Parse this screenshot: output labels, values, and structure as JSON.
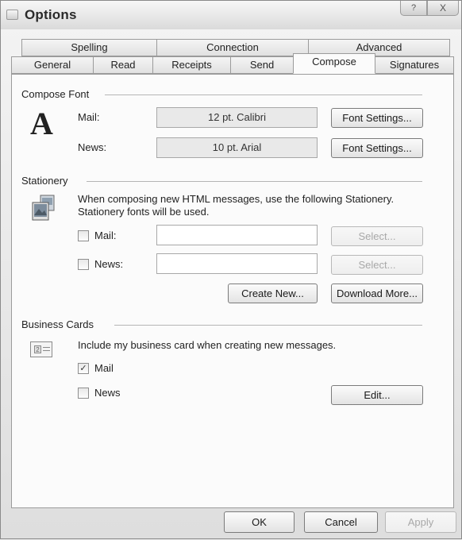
{
  "window": {
    "title": "Options",
    "help_label": "?",
    "close_label": "X"
  },
  "tabs_row1": [
    {
      "label": "Spelling"
    },
    {
      "label": "Connection"
    },
    {
      "label": "Advanced"
    }
  ],
  "tabs_row2": [
    {
      "label": "General"
    },
    {
      "label": "Read"
    },
    {
      "label": "Receipts"
    },
    {
      "label": "Send"
    },
    {
      "label": "Compose",
      "active": true
    },
    {
      "label": "Signatures"
    }
  ],
  "compose_font": {
    "group_label": "Compose Font",
    "icon": "font-A-icon",
    "mail_label": "Mail:",
    "mail_value": "12 pt. Calibri",
    "news_label": "News:",
    "news_value": "10 pt. Arial",
    "mail_button": "Font Settings...",
    "news_button": "Font Settings..."
  },
  "stationery": {
    "group_label": "Stationery",
    "icon": "stationery-icon",
    "description_line1": "When composing new HTML messages, use the following Stationery.",
    "description_line2": "Stationery fonts will be used.",
    "mail_label": "Mail:",
    "mail_checked": false,
    "mail_value": "",
    "news_label": "News:",
    "news_checked": false,
    "news_value": "",
    "select_mail_button": "Select...",
    "select_news_button": "Select...",
    "create_new_button": "Create New...",
    "download_more_button": "Download More..."
  },
  "business_cards": {
    "group_label": "Business Cards",
    "icon": "business-card-icon",
    "description": "Include my business card when creating new messages.",
    "mail_label": "Mail",
    "mail_checked": true,
    "news_label": "News",
    "news_checked": false,
    "edit_button": "Edit..."
  },
  "footer": {
    "ok": "OK",
    "cancel": "Cancel",
    "apply": "Apply"
  },
  "colors": {
    "panel_bg": "#fbfbfb",
    "window_bg": "#e8e8e8",
    "disabled_text": "#a8a8a8"
  }
}
